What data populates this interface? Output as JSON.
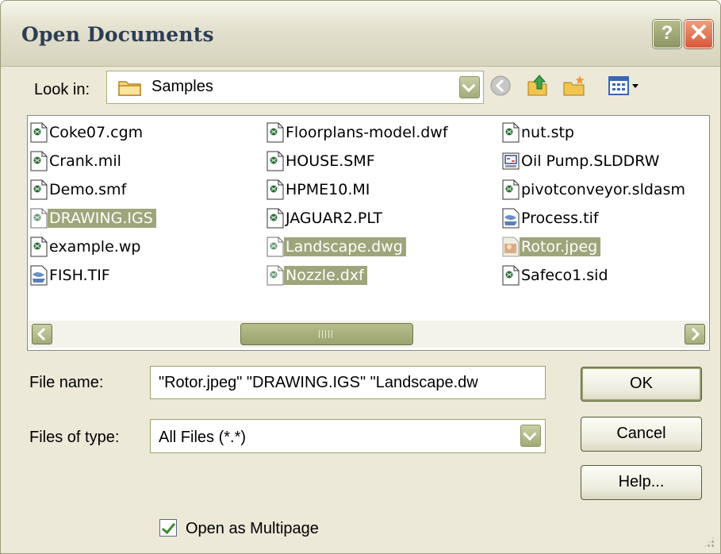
{
  "window": {
    "title": "Open Documents",
    "help_label": "?",
    "close_label": "✕"
  },
  "lookin": {
    "label": "Look in:",
    "value": "Samples",
    "toolbar_icons": [
      "back-icon",
      "up-folder-icon",
      "new-folder-icon",
      "view-menu-icon"
    ]
  },
  "files": [
    {
      "name": "Coke07.cgm",
      "selected": false,
      "icon": "document-icon"
    },
    {
      "name": "Crank.mil",
      "selected": false,
      "icon": "document-icon"
    },
    {
      "name": "Demo.smf",
      "selected": false,
      "icon": "document-icon"
    },
    {
      "name": "DRAWING.IGS",
      "selected": true,
      "icon": "document-icon"
    },
    {
      "name": "example.wp",
      "selected": false,
      "icon": "document-icon"
    },
    {
      "name": "FISH.TIF",
      "selected": false,
      "icon": "image-icon"
    },
    {
      "name": "Floorplans-model.dwf",
      "selected": false,
      "icon": "document-icon"
    },
    {
      "name": "HOUSE.SMF",
      "selected": false,
      "icon": "document-icon"
    },
    {
      "name": "HPME10.MI",
      "selected": false,
      "icon": "document-icon"
    },
    {
      "name": "JAGUAR2.PLT",
      "selected": false,
      "icon": "document-icon"
    },
    {
      "name": "Landscape.dwg",
      "selected": true,
      "icon": "document-icon"
    },
    {
      "name": "Nozzle.dxf",
      "selected": true,
      "icon": "document-icon"
    },
    {
      "name": "nut.stp",
      "selected": false,
      "icon": "document-icon"
    },
    {
      "name": "Oil Pump.SLDDRW",
      "selected": false,
      "icon": "drawing-icon"
    },
    {
      "name": "pivotconveyor.sldasm",
      "selected": false,
      "icon": "document-icon"
    },
    {
      "name": "Process.tif",
      "selected": false,
      "icon": "image-icon"
    },
    {
      "name": "Rotor.jpeg",
      "selected": true,
      "icon": "photo-icon"
    },
    {
      "name": "Safeco1.sid",
      "selected": false,
      "icon": "document-icon"
    }
  ],
  "scrollbar": {
    "left_icon": "scroll-left-icon",
    "right_icon": "scroll-right-icon"
  },
  "filename": {
    "label": "File name:",
    "value": "\"Rotor.jpeg\" \"DRAWING.IGS\" \"Landscape.dw"
  },
  "filetype": {
    "label": "Files of type:",
    "value": "All Files (*.*)"
  },
  "buttons": {
    "ok": "OK",
    "cancel": "Cancel",
    "help": "Help..."
  },
  "multipage": {
    "label": "Open as Multipage",
    "checked": true
  },
  "colors": {
    "selection": "#9ea57a",
    "accent": "#a4ac78",
    "title_text": "#2e3d56"
  }
}
